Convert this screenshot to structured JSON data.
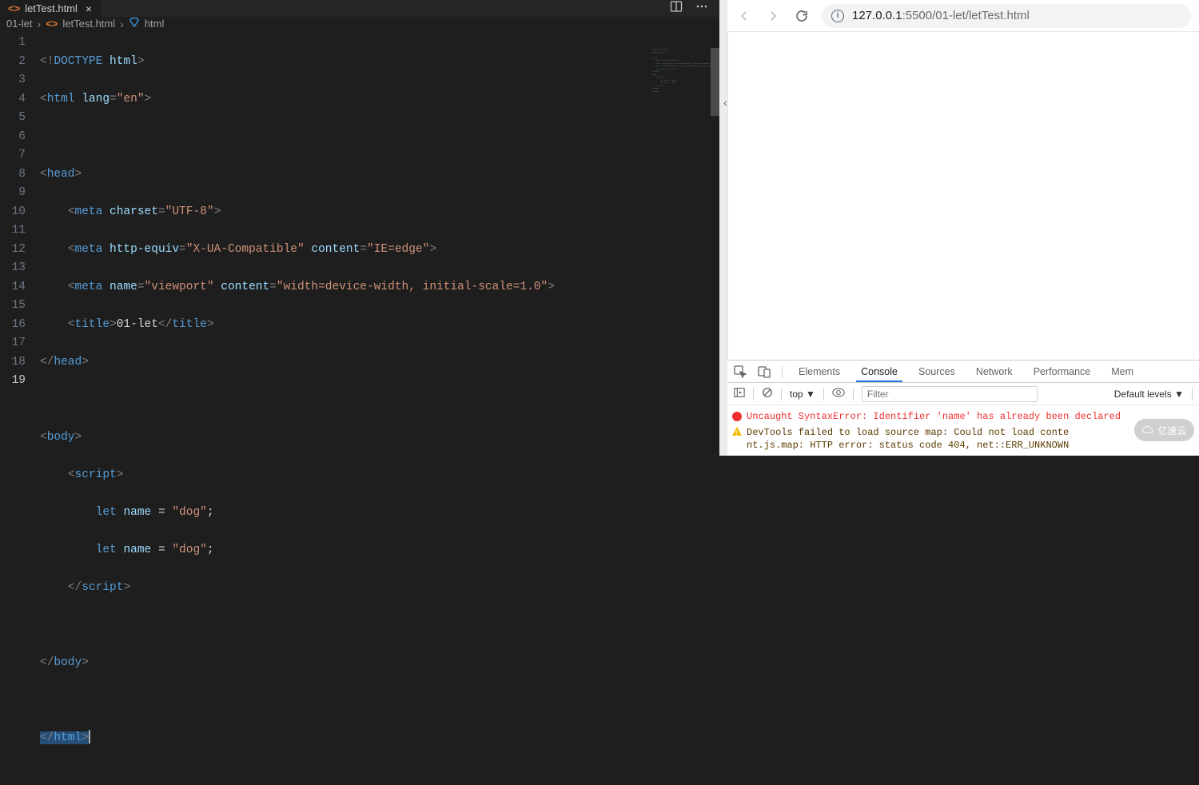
{
  "editor": {
    "tab": {
      "filename": "letTest.html"
    },
    "breadcrumb": {
      "folder": "01-let",
      "file": "letTest.html",
      "symbol": "html"
    },
    "lines": [
      "1",
      "2",
      "3",
      "4",
      "5",
      "6",
      "7",
      "8",
      "9",
      "10",
      "11",
      "12",
      "13",
      "14",
      "15",
      "16",
      "17",
      "18",
      "19"
    ],
    "code": {
      "doctype_bang": "!",
      "doctype": "DOCTYPE",
      "html_kw": "html",
      "html_tag": "html",
      "lang_attr": "lang",
      "lang_val": "\"en\"",
      "head": "head",
      "meta": "meta",
      "charset_attr": "charset",
      "charset_val": "\"UTF-8\"",
      "httpequiv_attr": "http-equiv",
      "httpequiv_val": "\"X-UA-Compatible\"",
      "content_attr": "content",
      "iedge_val": "\"IE=edge\"",
      "name_attr": "name",
      "vp_val": "\"viewport\"",
      "vp_content": "\"width=device-width, initial-scale=1.0\"",
      "title": "title",
      "title_text": "01-let",
      "body": "body",
      "script": "script",
      "let_kw": "let",
      "var_name": "name",
      "eq": "=",
      "dog": "\"dog\"",
      "semi": ";"
    }
  },
  "browser": {
    "url_host": "127.0.0.1",
    "url_port": ":5500",
    "url_path": "/01-let/letTest.html"
  },
  "devtools": {
    "tabs": {
      "elements": "Elements",
      "console": "Console",
      "sources": "Sources",
      "network": "Network",
      "performance": "Performance",
      "memory": "Mem"
    },
    "top": "top",
    "filter_placeholder": "Filter",
    "levels": "Default levels",
    "error": "Uncaught SyntaxError: Identifier 'name' has already been declared",
    "warning_l1": "DevTools failed to load source map: Could not load conte",
    "warning_l2": "nt.js.map: HTTP error: status code 404, net::ERR_UNKNOWN"
  },
  "watermark": "亿速云"
}
